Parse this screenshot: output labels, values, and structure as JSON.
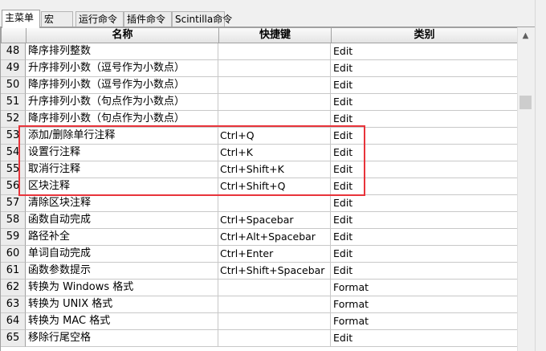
{
  "tabs": [
    {
      "label": "主菜单",
      "active": true
    },
    {
      "label": "宏",
      "active": false
    },
    {
      "label": "运行命令",
      "active": false
    },
    {
      "label": "插件命令",
      "active": false
    },
    {
      "label": "Scintilla命令",
      "active": false
    }
  ],
  "columns": {
    "num": "",
    "name": "名称",
    "shortcut": "快捷键",
    "category": "类别"
  },
  "rows": [
    {
      "num": "48",
      "name": "降序排列整数",
      "shortcut": "",
      "category": "Edit"
    },
    {
      "num": "49",
      "name": "升序排列小数（逗号作为小数点）",
      "shortcut": "",
      "category": "Edit"
    },
    {
      "num": "50",
      "name": "降序排列小数（逗号作为小数点）",
      "shortcut": "",
      "category": "Edit"
    },
    {
      "num": "51",
      "name": "升序排列小数（句点作为小数点）",
      "shortcut": "",
      "category": "Edit"
    },
    {
      "num": "52",
      "name": "降序排列小数（句点作为小数点）",
      "shortcut": "",
      "category": "Edit"
    },
    {
      "num": "53",
      "name": "添加/删除单行注释",
      "shortcut": "Ctrl+Q",
      "category": "Edit"
    },
    {
      "num": "54",
      "name": "设置行注释",
      "shortcut": "Ctrl+K",
      "category": "Edit"
    },
    {
      "num": "55",
      "name": "取消行注释",
      "shortcut": "Ctrl+Shift+K",
      "category": "Edit"
    },
    {
      "num": "56",
      "name": "区块注释",
      "shortcut": "Ctrl+Shift+Q",
      "category": "Edit"
    },
    {
      "num": "57",
      "name": "清除区块注释",
      "shortcut": "",
      "category": "Edit"
    },
    {
      "num": "58",
      "name": "函数自动完成",
      "shortcut": "Ctrl+Spacebar",
      "category": "Edit"
    },
    {
      "num": "59",
      "name": "路径补全",
      "shortcut": "Ctrl+Alt+Spacebar",
      "category": "Edit"
    },
    {
      "num": "60",
      "name": "单词自动完成",
      "shortcut": "Ctrl+Enter",
      "category": "Edit"
    },
    {
      "num": "61",
      "name": "函数参数提示",
      "shortcut": "Ctrl+Shift+Spacebar",
      "category": "Edit"
    },
    {
      "num": "62",
      "name": "转换为 Windows 格式",
      "shortcut": "",
      "category": "Format"
    },
    {
      "num": "63",
      "name": "转换为 UNIX 格式",
      "shortcut": "",
      "category": "Format"
    },
    {
      "num": "64",
      "name": "转换为 MAC 格式",
      "shortcut": "",
      "category": "Format"
    },
    {
      "num": "65",
      "name": "移除行尾空格",
      "shortcut": "",
      "category": "Edit"
    }
  ],
  "colors": {
    "highlight_border": "#e8343b",
    "header_border": "#a0a0a0"
  },
  "icons": {
    "scroll_up": "chevron-up-icon"
  }
}
